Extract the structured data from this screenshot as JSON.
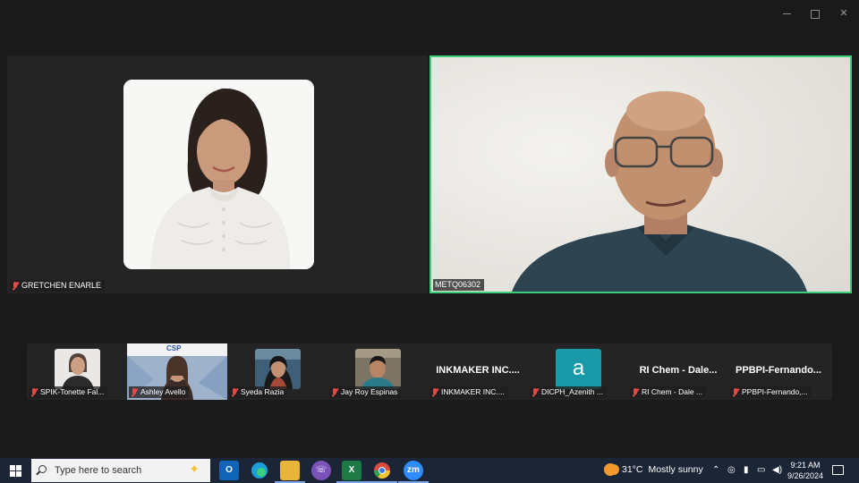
{
  "window": {
    "minimize_label": "",
    "maximize_label": "",
    "close_label": "✕"
  },
  "main_tiles": [
    {
      "name": "GRETCHEN ENARLE",
      "muted": true
    },
    {
      "name": "METQ06302",
      "muted": false
    }
  ],
  "thumbnails": [
    {
      "name": "SPIK-Tonette Fal...",
      "type": "video"
    },
    {
      "name": "Ashley Avello",
      "type": "video"
    },
    {
      "name": "Syeda Razia",
      "type": "video"
    },
    {
      "name": "Jay Roy Espinas",
      "type": "video"
    },
    {
      "name": "INKMAKER INC....",
      "big_name": "INKMAKER INC....",
      "type": "name"
    },
    {
      "name": "DICPH_Azenith ...",
      "letter": "a",
      "type": "letter"
    },
    {
      "name": "RI Chem - Dale ...",
      "big_name": "RI Chem - Dale...",
      "type": "name"
    },
    {
      "name": "PPBPI-Fernando,...",
      "big_name": "PPBPI-Fernando...",
      "type": "name"
    }
  ],
  "thumbnail_banner": "CSP",
  "taskbar": {
    "search_placeholder": "Type here to search",
    "apps": [
      "outlook-icon",
      "edge-icon",
      "file-explorer-icon",
      "viber-icon",
      "excel-icon",
      "chrome-icon",
      "zoom-icon"
    ],
    "zoom_label": "zm",
    "weather_temp": "31°C",
    "weather_desc": "Mostly sunny",
    "time": "9:21 AM",
    "date": "9/26/2024"
  },
  "colors": {
    "active_speaker_border": "#3ccf7a",
    "muted_mic": "#e24a4a",
    "letter_tile": "#1a9aa8",
    "taskbar": "#1c2536"
  }
}
